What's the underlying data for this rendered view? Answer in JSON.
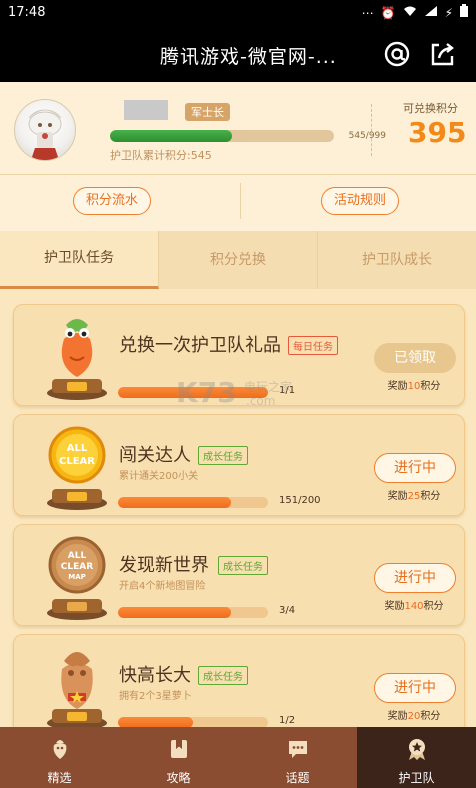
{
  "status_bar": {
    "time": "17:48"
  },
  "title_bar": {
    "title": "腾讯游戏-微官网-..."
  },
  "profile": {
    "rank": "军士长",
    "xp_text": "545/999",
    "xp_fraction": 0.5455,
    "accumulated": "护卫队累计积分:545",
    "points_label": "可兑换积分",
    "points_value": "395"
  },
  "actions": {
    "flow": "积分流水",
    "rules": "活动规则"
  },
  "tabs": [
    {
      "label": "护卫队任务"
    },
    {
      "label": "积分兑换"
    },
    {
      "label": "护卫队成长"
    }
  ],
  "tasks": [
    {
      "title": "兑换一次护卫队礼品",
      "tag": "每日任务",
      "desc": "",
      "progress_text": "1/1",
      "progress_fraction": 1.0,
      "button": "已领取",
      "reward_pre": "奖励",
      "reward_num": "10",
      "reward_post": "积分"
    },
    {
      "title": "闯关达人",
      "tag": "成长任务",
      "desc": "累计通关200小关",
      "progress_text": "151/200",
      "progress_fraction": 0.755,
      "button": "进行中",
      "reward_pre": "奖励",
      "reward_num": "25",
      "reward_post": "积分"
    },
    {
      "title": "发现新世界",
      "tag": "成长任务",
      "desc": "开启4个新地图冒险",
      "progress_text": "3/4",
      "progress_fraction": 0.75,
      "button": "进行中",
      "reward_pre": "奖励",
      "reward_num": "140",
      "reward_post": "积分"
    },
    {
      "title": "快高长大",
      "tag": "成长任务",
      "desc": "拥有2个3星萝卜",
      "progress_text": "1/2",
      "progress_fraction": 0.5,
      "button": "进行中",
      "reward_pre": "奖励",
      "reward_num": "20",
      "reward_post": "积分"
    }
  ],
  "watermark": {
    "main": "K73",
    "sub": "电玩之家",
    "url": ".com"
  },
  "bottom_nav": [
    {
      "label": "精选",
      "icon": "carrot-icon"
    },
    {
      "label": "攻略",
      "icon": "bookmark-icon"
    },
    {
      "label": "话题",
      "icon": "chat-icon"
    },
    {
      "label": "护卫队",
      "icon": "medal-icon"
    }
  ],
  "colors": {
    "accent": "#ee7f2d",
    "progress": "#fb8a37",
    "xp": "#48b24a",
    "nav": "#8a4d31",
    "nav_active": "#3c241a"
  }
}
